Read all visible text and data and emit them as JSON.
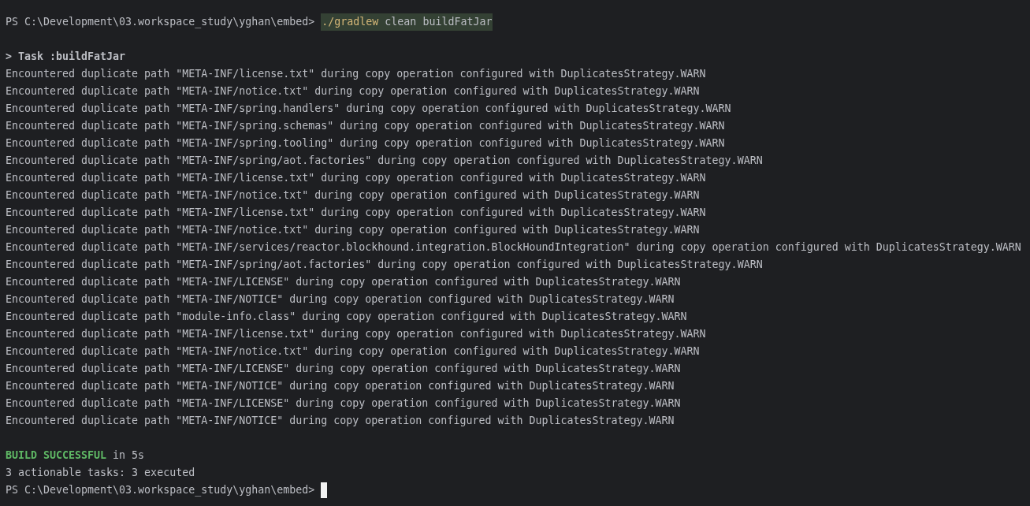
{
  "lines": [
    {
      "kind": "command",
      "prompt": "PS C:\\Development\\03.workspace_study\\yghan\\embed>",
      "program": "./gradlew",
      "args": "clean buildFatJar"
    },
    {
      "kind": "blank"
    },
    {
      "kind": "task",
      "text": "> Task :buildFatJar"
    },
    {
      "kind": "plain",
      "text": "Encountered duplicate path \"META-INF/license.txt\" during copy operation configured with DuplicatesStrategy.WARN"
    },
    {
      "kind": "plain",
      "text": "Encountered duplicate path \"META-INF/notice.txt\" during copy operation configured with DuplicatesStrategy.WARN"
    },
    {
      "kind": "plain",
      "text": "Encountered duplicate path \"META-INF/spring.handlers\" during copy operation configured with DuplicatesStrategy.WARN"
    },
    {
      "kind": "plain",
      "text": "Encountered duplicate path \"META-INF/spring.schemas\" during copy operation configured with DuplicatesStrategy.WARN"
    },
    {
      "kind": "plain",
      "text": "Encountered duplicate path \"META-INF/spring.tooling\" during copy operation configured with DuplicatesStrategy.WARN"
    },
    {
      "kind": "plain",
      "text": "Encountered duplicate path \"META-INF/spring/aot.factories\" during copy operation configured with DuplicatesStrategy.WARN"
    },
    {
      "kind": "plain",
      "text": "Encountered duplicate path \"META-INF/license.txt\" during copy operation configured with DuplicatesStrategy.WARN"
    },
    {
      "kind": "plain",
      "text": "Encountered duplicate path \"META-INF/notice.txt\" during copy operation configured with DuplicatesStrategy.WARN"
    },
    {
      "kind": "plain",
      "text": "Encountered duplicate path \"META-INF/license.txt\" during copy operation configured with DuplicatesStrategy.WARN"
    },
    {
      "kind": "plain",
      "text": "Encountered duplicate path \"META-INF/notice.txt\" during copy operation configured with DuplicatesStrategy.WARN"
    },
    {
      "kind": "plain",
      "text": "Encountered duplicate path \"META-INF/services/reactor.blockhound.integration.BlockHoundIntegration\" during copy operation configured with DuplicatesStrategy.WARN"
    },
    {
      "kind": "plain",
      "text": "Encountered duplicate path \"META-INF/spring/aot.factories\" during copy operation configured with DuplicatesStrategy.WARN"
    },
    {
      "kind": "plain",
      "text": "Encountered duplicate path \"META-INF/LICENSE\" during copy operation configured with DuplicatesStrategy.WARN"
    },
    {
      "kind": "plain",
      "text": "Encountered duplicate path \"META-INF/NOTICE\" during copy operation configured with DuplicatesStrategy.WARN"
    },
    {
      "kind": "plain",
      "text": "Encountered duplicate path \"module-info.class\" during copy operation configured with DuplicatesStrategy.WARN"
    },
    {
      "kind": "plain",
      "text": "Encountered duplicate path \"META-INF/license.txt\" during copy operation configured with DuplicatesStrategy.WARN"
    },
    {
      "kind": "plain",
      "text": "Encountered duplicate path \"META-INF/notice.txt\" during copy operation configured with DuplicatesStrategy.WARN"
    },
    {
      "kind": "plain",
      "text": "Encountered duplicate path \"META-INF/LICENSE\" during copy operation configured with DuplicatesStrategy.WARN"
    },
    {
      "kind": "plain",
      "text": "Encountered duplicate path \"META-INF/NOTICE\" during copy operation configured with DuplicatesStrategy.WARN"
    },
    {
      "kind": "plain",
      "text": "Encountered duplicate path \"META-INF/LICENSE\" during copy operation configured with DuplicatesStrategy.WARN"
    },
    {
      "kind": "plain",
      "text": "Encountered duplicate path \"META-INF/NOTICE\" during copy operation configured with DuplicatesStrategy.WARN"
    },
    {
      "kind": "blank"
    },
    {
      "kind": "success",
      "status": "BUILD SUCCESSFUL",
      "text": "in 5s"
    },
    {
      "kind": "plain",
      "text": "3 actionable tasks: 3 executed"
    },
    {
      "kind": "prompt",
      "prompt": "PS C:\\Development\\03.workspace_study\\yghan\\embed>"
    }
  ]
}
